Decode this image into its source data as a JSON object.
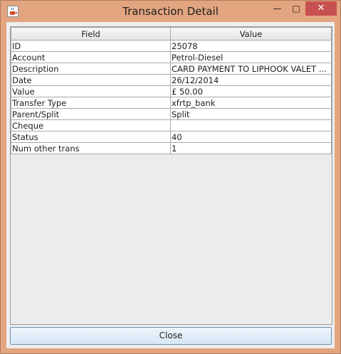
{
  "window": {
    "title": "Transaction Detail",
    "icon": "java-cup-icon",
    "controls": {
      "minimize": "—",
      "maximize": "□",
      "close": "✕"
    }
  },
  "table": {
    "columns": [
      "Field",
      "Value"
    ],
    "rows": [
      {
        "field": "ID",
        "value": "25078"
      },
      {
        "field": "Account",
        "value": "Petrol-Diesel"
      },
      {
        "field": "Description",
        "value": "CARD PAYMENT TO LIPHOOK VALET ..."
      },
      {
        "field": "Date",
        "value": "26/12/2014"
      },
      {
        "field": "Value",
        "value": "£ 50.00"
      },
      {
        "field": "Transfer Type",
        "value": "xfrtp_bank"
      },
      {
        "field": "Parent/Split",
        "value": "Split"
      },
      {
        "field": "Cheque",
        "value": ""
      },
      {
        "field": "Status",
        "value": "40"
      },
      {
        "field": "Num other trans",
        "value": "1"
      }
    ]
  },
  "buttons": {
    "close_label": "Close"
  }
}
